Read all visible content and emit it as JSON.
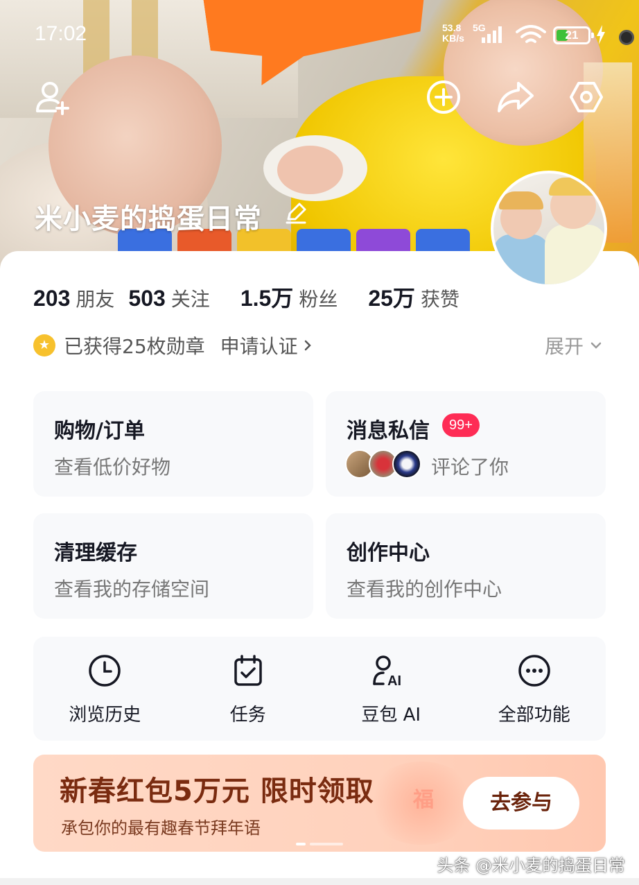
{
  "status_bar": {
    "time": "17:02",
    "net_speed": "53.8",
    "net_unit": "KB/s",
    "net_type": "5G",
    "battery": "21"
  },
  "header": {
    "profile_name": "米小麦的捣蛋日常",
    "icons": [
      "add-friend-icon",
      "plus-circle-icon",
      "share-icon",
      "settings-icon",
      "edit-icon"
    ]
  },
  "stats": [
    {
      "value": "203",
      "label": "朋友"
    },
    {
      "value": "503",
      "label": "关注"
    },
    {
      "value": "1.5万",
      "label": "粉丝"
    },
    {
      "value": "25万",
      "label": "获赞"
    }
  ],
  "badges": {
    "medal_text": "已获得25枚勋章",
    "verify_text": "申请认证",
    "expand_text": "展开"
  },
  "cards": {
    "shopping": {
      "title": "购物/订单",
      "subtitle": "查看低价好物"
    },
    "messages": {
      "title": "消息私信",
      "badge": "99+",
      "subtitle": "评论了你"
    },
    "cache": {
      "title": "清理缓存",
      "subtitle": "查看我的存储空间"
    },
    "creator": {
      "title": "创作中心",
      "subtitle": "查看我的创作中心"
    }
  },
  "shortcuts": [
    {
      "label": "浏览历史",
      "icon": "clock-icon"
    },
    {
      "label": "任务",
      "icon": "calendar-check-icon"
    },
    {
      "label": "豆包 AI",
      "icon": "ai-person-icon"
    },
    {
      "label": "全部功能",
      "icon": "more-dots-icon"
    }
  ],
  "banner": {
    "headline": "新春红包5万元 限时领取",
    "subtitle": "承包你的最有趣春节拜年语",
    "button": "去参与",
    "deco_glyph": "福"
  },
  "watermark": "头条 @米小麦的捣蛋日常",
  "colors": {
    "accent_red": "#fe2c55",
    "banner_bg": "#ffd2bd",
    "banner_text": "#7a2b10",
    "medal": "#f7c12d"
  }
}
